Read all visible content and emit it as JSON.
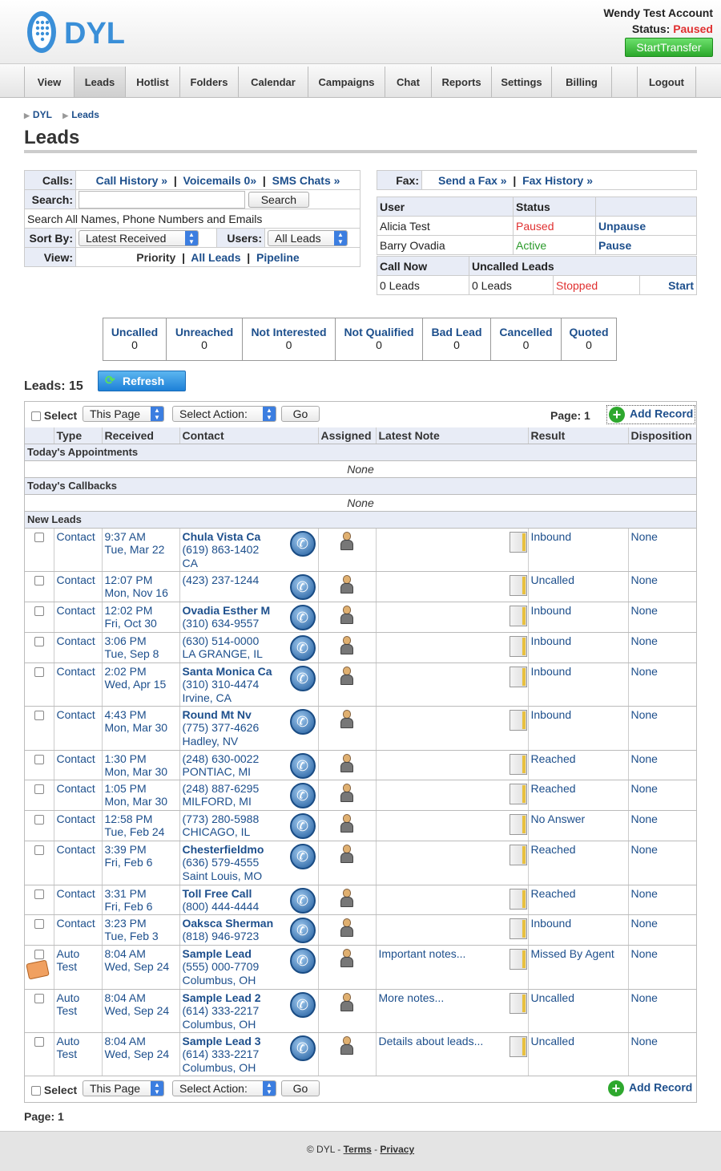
{
  "header": {
    "account": "Wendy Test Account",
    "status_label": "Status:",
    "status_value": "Paused",
    "start_transfer": "StartTransfer",
    "logo_text": "DYL",
    "accent": "#2aa82a"
  },
  "nav": [
    "View",
    "Leads",
    "Hotlist",
    "Folders",
    "Calendar",
    "Campaigns",
    "Chat",
    "Reports",
    "Settings",
    "Billing",
    "",
    "Logout"
  ],
  "breadcrumb": [
    "DYL",
    "Leads"
  ],
  "page_title": "Leads",
  "calls_panel": {
    "calls_label": "Calls:",
    "call_history": "Call History »",
    "voicemails": "Voicemails 0»",
    "sms_chats": "SMS Chats »",
    "search_label": "Search:",
    "search_button": "Search",
    "search_hint": "Search All Names, Phone Numbers and Emails",
    "sortby_label": "Sort By:",
    "sortby_value": "Latest Received",
    "users_label": "Users:",
    "users_value": "All Leads",
    "view_label": "View:",
    "view_priority": "Priority",
    "view_all": "All Leads",
    "view_pipeline": "Pipeline"
  },
  "fax_panel": {
    "label": "Fax:",
    "send": "Send a Fax »",
    "history": "Fax History »"
  },
  "users_table": {
    "headers": [
      "User",
      "Status",
      ""
    ],
    "rows": [
      {
        "user": "Alicia Test",
        "status": "Paused",
        "action": "Unpause"
      },
      {
        "user": "Barry Ovadia",
        "status": "Active",
        "action": "Pause"
      }
    ]
  },
  "callnow": {
    "h1": "Call Now",
    "h2": "Uncalled Leads",
    "v1": "0 Leads",
    "v2": "0 Leads",
    "status": "Stopped",
    "action": "Start"
  },
  "stages": [
    {
      "t": "Uncalled",
      "n": "0"
    },
    {
      "t": "Unreached",
      "n": "0"
    },
    {
      "t": "Not Interested",
      "n": "0"
    },
    {
      "t": "Not Qualified",
      "n": "0"
    },
    {
      "t": "Bad Lead",
      "n": "0"
    },
    {
      "t": "Cancelled",
      "n": "0"
    },
    {
      "t": "Quoted",
      "n": "0"
    }
  ],
  "leads_count": "Leads: 15",
  "refresh": "Refresh",
  "toolbar": {
    "select": "Select",
    "this_page": "This Page",
    "select_action": "Select Action:",
    "go": "Go",
    "page": "Page: 1",
    "add_record": "Add Record"
  },
  "columns": [
    "Type",
    "Received",
    "Contact",
    "Assigned",
    "Latest Note",
    "Result",
    "Disposition"
  ],
  "sections": {
    "appointments": "Today's Appointments",
    "callbacks": "Today's Callbacks",
    "new_leads": "New Leads",
    "none": "None"
  },
  "rows": [
    {
      "type": [
        "Contact"
      ],
      "time": "9:37 AM",
      "date": "Tue, Mar 22",
      "name": "Chula Vista Ca",
      "phone": "(619) 863-1402",
      "loc": "CA",
      "note": "",
      "result": "Inbound",
      "disp": "None"
    },
    {
      "type": [
        "Contact"
      ],
      "time": "12:07 PM",
      "date": "Mon, Nov 16",
      "name": "",
      "phone": "(423) 237-1244",
      "loc": "",
      "note": "",
      "result": "Uncalled",
      "disp": "None"
    },
    {
      "type": [
        "Contact"
      ],
      "time": "12:02 PM",
      "date": "Fri, Oct 30",
      "name": "Ovadia Esther M",
      "phone": "(310) 634-9557",
      "loc": "",
      "note": "",
      "result": "Inbound",
      "disp": "None"
    },
    {
      "type": [
        "Contact"
      ],
      "time": "3:06 PM",
      "date": "Tue, Sep 8",
      "name": "",
      "phone": "(630) 514-0000",
      "loc": "LA GRANGE, IL",
      "note": "",
      "result": "Inbound",
      "disp": "None"
    },
    {
      "type": [
        "Contact"
      ],
      "time": "2:02 PM",
      "date": "Wed, Apr 15",
      "name": "Santa Monica Ca",
      "phone": "(310) 310-4474",
      "loc": "Irvine, CA",
      "note": "",
      "result": "Inbound",
      "disp": "None"
    },
    {
      "type": [
        "Contact"
      ],
      "time": "4:43 PM",
      "date": "Mon, Mar 30",
      "name": "Round Mt Nv",
      "phone": "(775) 377-4626",
      "loc": "Hadley, NV",
      "note": "",
      "result": "Inbound",
      "disp": "None"
    },
    {
      "type": [
        "Contact"
      ],
      "time": "1:30 PM",
      "date": "Mon, Mar 30",
      "name": "",
      "phone": "(248) 630-0022",
      "loc": "PONTIAC, MI",
      "note": "",
      "result": "Reached",
      "disp": "None"
    },
    {
      "type": [
        "Contact"
      ],
      "time": "1:05 PM",
      "date": "Mon, Mar 30",
      "name": "",
      "phone": "(248) 887-6295",
      "loc": "MILFORD, MI",
      "note": "",
      "result": "Reached",
      "disp": "None"
    },
    {
      "type": [
        "Contact"
      ],
      "time": "12:58 PM",
      "date": "Tue, Feb 24",
      "name": "",
      "phone": "(773) 280-5988",
      "loc": "CHICAGO, IL",
      "note": "",
      "result": "No Answer",
      "disp": "None"
    },
    {
      "type": [
        "Contact"
      ],
      "time": "3:39 PM",
      "date": "Fri, Feb 6",
      "name": "Chesterfieldmo",
      "phone": "(636) 579-4555",
      "loc": "Saint Louis, MO",
      "note": "",
      "result": "Reached",
      "disp": "None"
    },
    {
      "type": [
        "Contact"
      ],
      "time": "3:31 PM",
      "date": "Fri, Feb 6",
      "name": "Toll Free Call",
      "phone": "(800) 444-4444",
      "loc": "",
      "note": "",
      "result": "Reached",
      "disp": "None"
    },
    {
      "type": [
        "Contact"
      ],
      "time": "3:23 PM",
      "date": "Tue, Feb 3",
      "name": "Oaksca Sherman",
      "phone": "(818) 946-9723",
      "loc": "",
      "note": "",
      "result": "Inbound",
      "disp": "None"
    },
    {
      "type": [
        "Auto",
        "Test"
      ],
      "time": "8:04 AM",
      "date": "Wed, Sep 24",
      "name": "Sample Lead",
      "phone": "(555) 000-7709",
      "loc": "Columbus, OH",
      "note": "Important notes...",
      "result": "Missed By Agent",
      "disp": "None",
      "book": true
    },
    {
      "type": [
        "Auto",
        "Test"
      ],
      "time": "8:04 AM",
      "date": "Wed, Sep 24",
      "name": "Sample Lead 2",
      "phone": "(614) 333-2217",
      "loc": "Columbus, OH",
      "note": "More notes...",
      "result": "Uncalled",
      "disp": "None"
    },
    {
      "type": [
        "Auto",
        "Test"
      ],
      "time": "8:04 AM",
      "date": "Wed, Sep 24",
      "name": "Sample Lead 3",
      "phone": "(614) 333-2217",
      "loc": "Columbus, OH",
      "note": "Details about leads...",
      "result": "Uncalled",
      "disp": "None"
    }
  ],
  "page_bottom": "Page: 1",
  "footer": {
    "copy": "© DYL - ",
    "terms": "Terms",
    "sep": " - ",
    "privacy": "Privacy"
  }
}
